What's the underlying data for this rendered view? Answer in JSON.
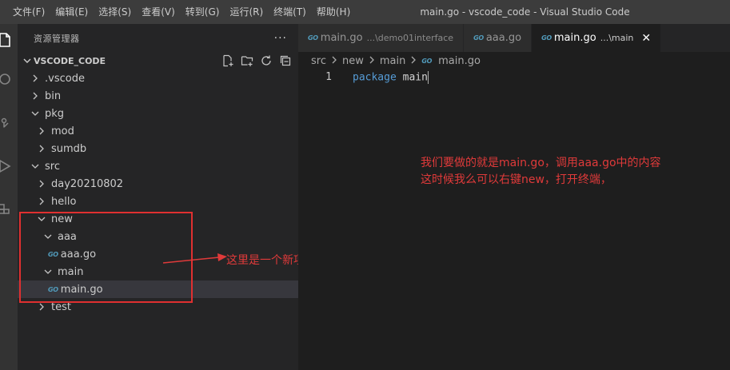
{
  "menu": [
    "文件(F)",
    "编辑(E)",
    "选择(S)",
    "查看(V)",
    "转到(G)",
    "运行(R)",
    "终端(T)",
    "帮助(H)"
  ],
  "window_title": "main.go - vscode_code - Visual Studio Code",
  "activity_icons": [
    "explorer-icon",
    "search-icon",
    "source-control-icon",
    "run-debug-icon",
    "extensions-icon"
  ],
  "sidebar": {
    "title": "资源管理器",
    "more": "···",
    "section": "VSCODE_CODE",
    "actions": [
      "new-file-icon",
      "new-folder-icon",
      "refresh-icon",
      "collapse-all-icon"
    ],
    "tree": [
      {
        "label": ".vscode",
        "kind": "folder",
        "open": false,
        "depth": 0
      },
      {
        "label": "bin",
        "kind": "folder",
        "open": false,
        "depth": 0
      },
      {
        "label": "pkg",
        "kind": "folder",
        "open": true,
        "depth": 0
      },
      {
        "label": "mod",
        "kind": "folder",
        "open": false,
        "depth": 1
      },
      {
        "label": "sumdb",
        "kind": "folder",
        "open": false,
        "depth": 1
      },
      {
        "label": "src",
        "kind": "folder",
        "open": true,
        "depth": 0
      },
      {
        "label": "day20210802",
        "kind": "folder",
        "open": false,
        "depth": 1
      },
      {
        "label": "hello",
        "kind": "folder",
        "open": false,
        "depth": 1
      },
      {
        "label": "new",
        "kind": "folder",
        "open": true,
        "depth": 1
      },
      {
        "label": "aaa",
        "kind": "folder",
        "open": true,
        "depth": 2
      },
      {
        "label": "aaa.go",
        "kind": "file",
        "depth": 3
      },
      {
        "label": "main",
        "kind": "folder",
        "open": true,
        "depth": 2
      },
      {
        "label": "main.go",
        "kind": "file",
        "depth": 3,
        "selected": true
      },
      {
        "label": "test",
        "kind": "folder",
        "open": false,
        "depth": 1
      }
    ],
    "go_badge": "GO"
  },
  "tabs": [
    {
      "name": "main.go",
      "desc": "...\\demo01interface",
      "active": false
    },
    {
      "name": "aaa.go",
      "desc": "",
      "active": false
    },
    {
      "name": "main.go",
      "desc": "...\\main",
      "active": true
    }
  ],
  "tab_close": "✕",
  "breadcrumb": [
    "src",
    "new",
    "main",
    "main.go"
  ],
  "code": {
    "line_number": "1",
    "keyword": "package",
    "identifier": "main"
  },
  "annotations": {
    "arrow_note": "这里是一个新项目",
    "editor_note_line1": "我们要做的就是main.go，调用aaa.go中的内容",
    "editor_note_line2": "这时候我么可以右键new，打开终端，"
  },
  "colors": {
    "annotation": "#e03a3a",
    "go_icon": "#519aba",
    "keyword": "#569cd6"
  }
}
